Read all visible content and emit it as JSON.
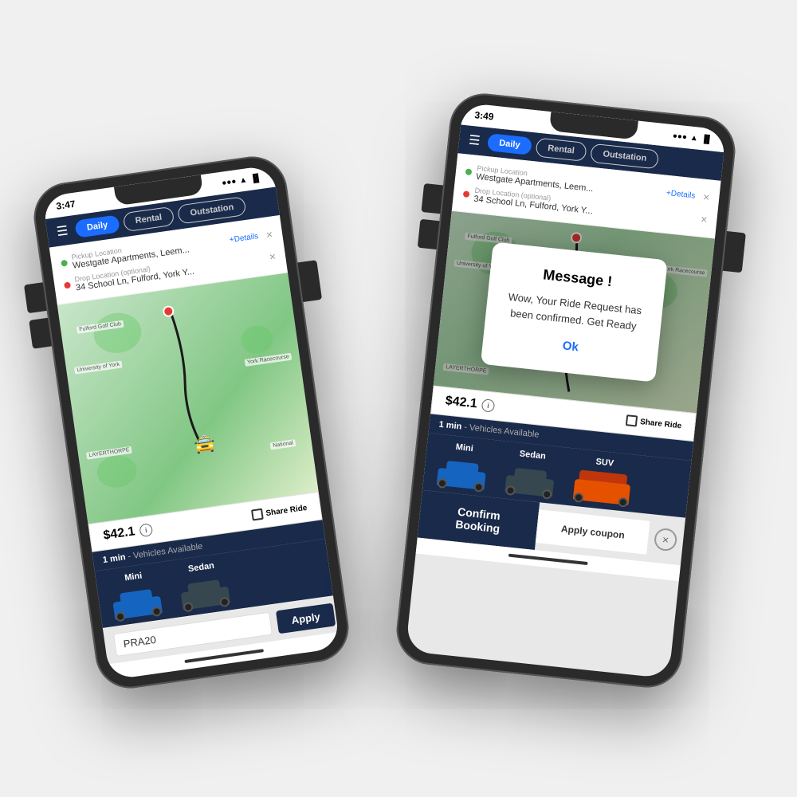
{
  "phones": {
    "left": {
      "statusBar": {
        "time": "3:47",
        "icons": "●●● ▲ 📶"
      },
      "tabs": [
        "Daily",
        "Rental",
        "Outstation"
      ],
      "activeTab": "Daily",
      "pickup": {
        "label": "Pickup Location",
        "value": "Westgate Apartments, Leem..."
      },
      "drop": {
        "label": "Drop Location (optional)",
        "value": "34 School Ln, Fulford, York Y..."
      },
      "detailsLink": "+Details",
      "price": "$42.1",
      "shareRide": "Share Ride",
      "vehiclesHeader": "1 min",
      "vehiclesSubHeader": " - Vehicles Available",
      "vehicles": [
        {
          "name": "Mini",
          "type": "blue"
        },
        {
          "name": "Sedan",
          "type": "dark"
        }
      ],
      "coupon": {
        "placeholder": "PRA20",
        "applyLabel": "Apply"
      }
    },
    "right": {
      "statusBar": {
        "time": "3:49",
        "icons": "●●● ▲ 📶 🔋"
      },
      "tabs": [
        "Daily",
        "Rental",
        "Outstation"
      ],
      "activeTab": "Daily",
      "pickup": {
        "label": "Pickup Location",
        "value": "Westgate Apartments, Leem..."
      },
      "drop": {
        "label": "Drop Location (optional)",
        "value": "34 School Ln, Fulford, York Y..."
      },
      "detailsLink": "+Details",
      "price": "$42.1",
      "shareRide": "Share Ride",
      "vehiclesHeader": "1 min",
      "vehiclesSubHeader": " - Vehicles Available",
      "vehicles": [
        {
          "name": "Mini",
          "type": "blue"
        },
        {
          "name": "Sedan",
          "type": "dark"
        },
        {
          "name": "SUV",
          "type": "orange"
        }
      ],
      "dialog": {
        "title": "Message !",
        "message": "Wow, Your Ride Request has been confirmed. Get Ready",
        "okLabel": "Ok"
      },
      "confirmBtn": "Confirm Booking",
      "couponBtn": "Apply coupon"
    }
  }
}
